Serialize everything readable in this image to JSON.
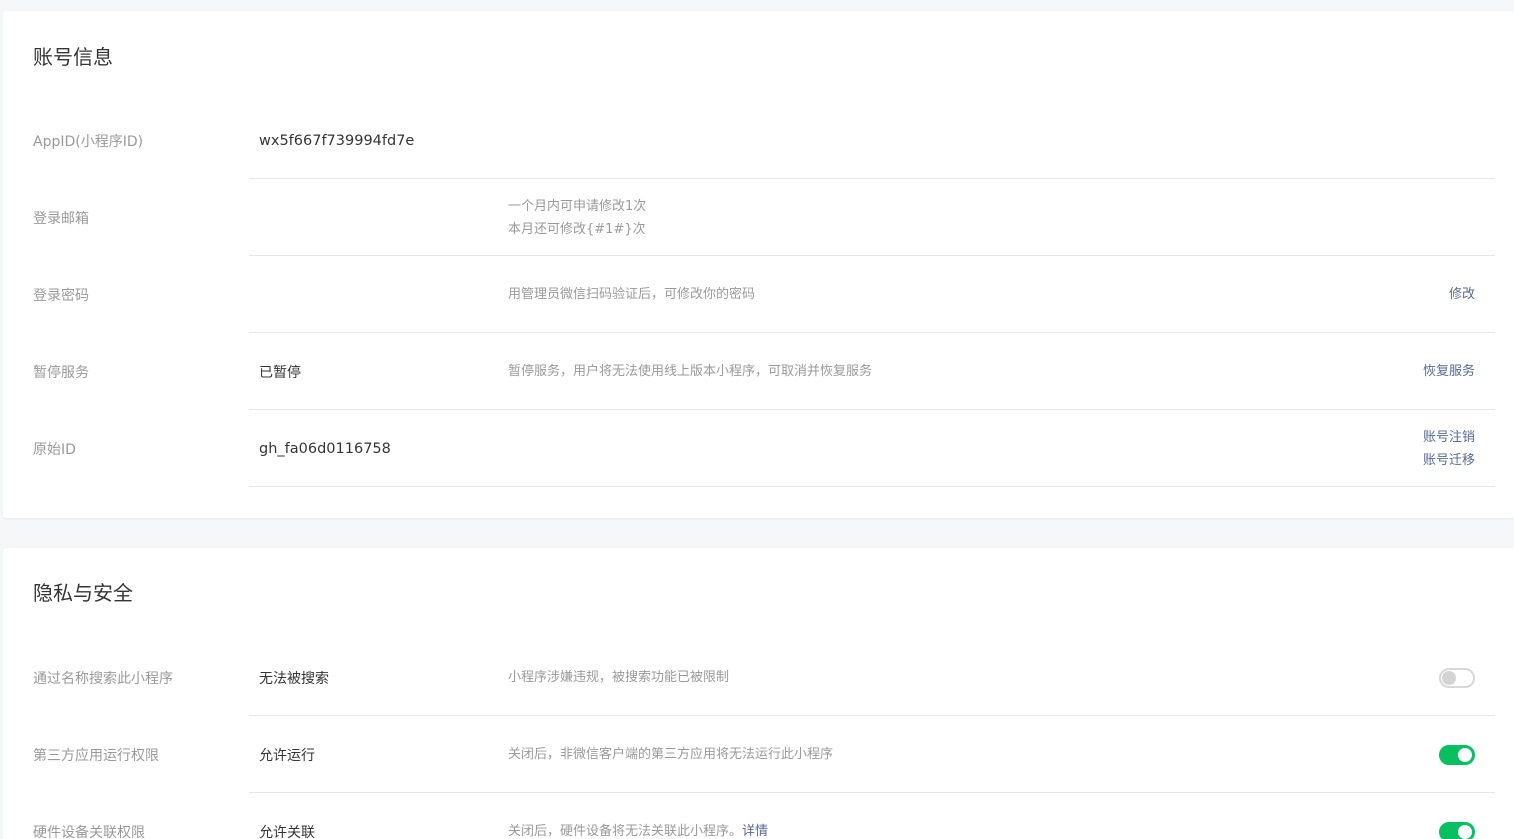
{
  "account": {
    "title": "账号信息",
    "rows": [
      {
        "label": "AppID(小程序ID)",
        "value": "wx5f667f739994fd7e"
      },
      {
        "label": "登录邮箱",
        "value": "",
        "desc": [
          "一个月内可申请修改1次",
          "本月还可修改{#1#}次"
        ]
      },
      {
        "label": "登录密码",
        "value": "",
        "desc": [
          "用管理员微信扫码验证后，可修改你的密码"
        ],
        "actions": [
          "修改"
        ]
      },
      {
        "label": "暂停服务",
        "value": "已暂停",
        "desc": [
          "暂停服务，用户将无法使用线上版本小程序，可取消并恢复服务"
        ],
        "actions": [
          "恢复服务"
        ]
      },
      {
        "label": "原始ID",
        "value": "gh_fa06d0116758",
        "actions": [
          "账号注销",
          "账号迁移"
        ]
      }
    ]
  },
  "privacy": {
    "title": "隐私与安全",
    "rows": [
      {
        "label": "通过名称搜索此小程序",
        "value": "无法被搜索",
        "desc": "小程序涉嫌违规，被搜索功能已被限制",
        "toggle_on": false
      },
      {
        "label": "第三方应用运行权限",
        "value": "允许运行",
        "desc": "关闭后，非微信客户端的第三方应用将无法运行此小程序",
        "toggle_on": true
      },
      {
        "label": "硬件设备关联权限",
        "value": "允许关联",
        "desc": "关闭后，硬件设备将无法关联此小程序。",
        "desc_link": "详情",
        "toggle_on": true
      }
    ]
  },
  "colors": {
    "link": "#576b95",
    "toggle_on": "#07c160",
    "label": "#9a9a9a",
    "text": "#353535"
  }
}
